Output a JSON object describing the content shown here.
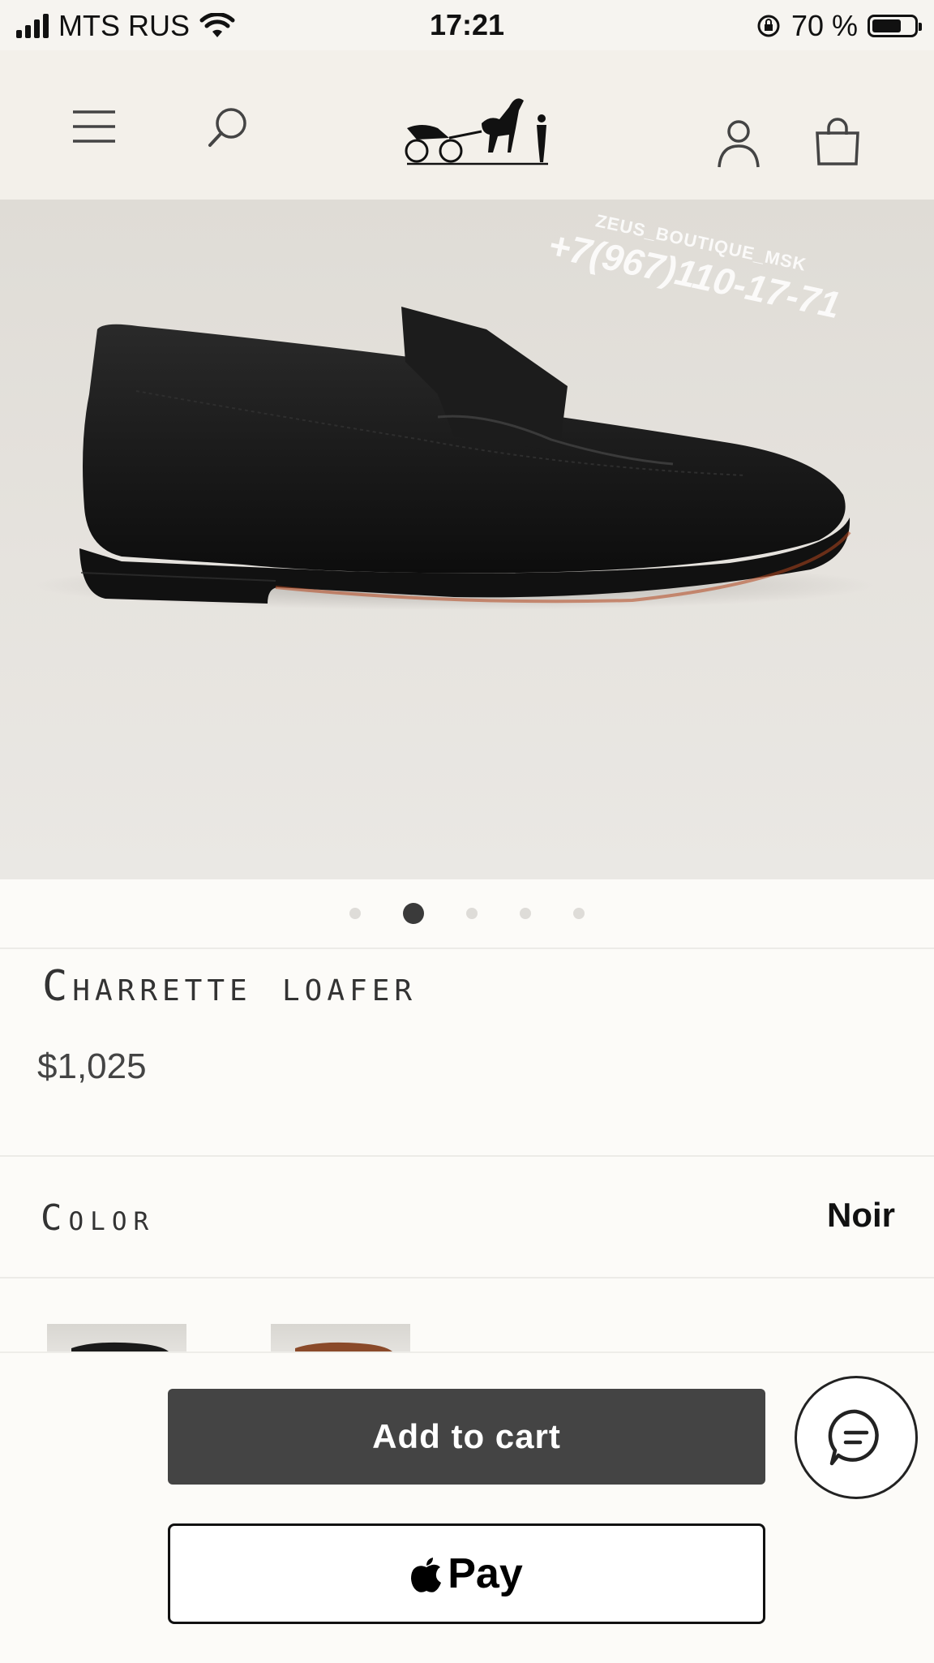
{
  "status_bar": {
    "carrier": "MTS RUS",
    "time": "17:21",
    "battery_percent": "70 %",
    "battery_level": 0.7,
    "icons": [
      "signal-icon",
      "wifi-icon",
      "rotation-lock-icon",
      "battery-icon"
    ]
  },
  "header": {
    "icons": [
      "menu-icon",
      "search-icon",
      "brand-logo",
      "account-icon",
      "shopping-bag-icon"
    ]
  },
  "gallery": {
    "slide_count": 5,
    "active_index": 1,
    "watermark": {
      "line1": "ZEUS_BOUTIQUE_MSK",
      "line2": "+7(967)110-17-71"
    }
  },
  "product": {
    "name": "Charrette loafer",
    "price": "$1,025"
  },
  "color": {
    "label": "Color",
    "value": "Noir"
  },
  "actions": {
    "add_to_cart": "Add to cart",
    "apple_pay": "Pay",
    "chat_icon": "chat-icon"
  }
}
